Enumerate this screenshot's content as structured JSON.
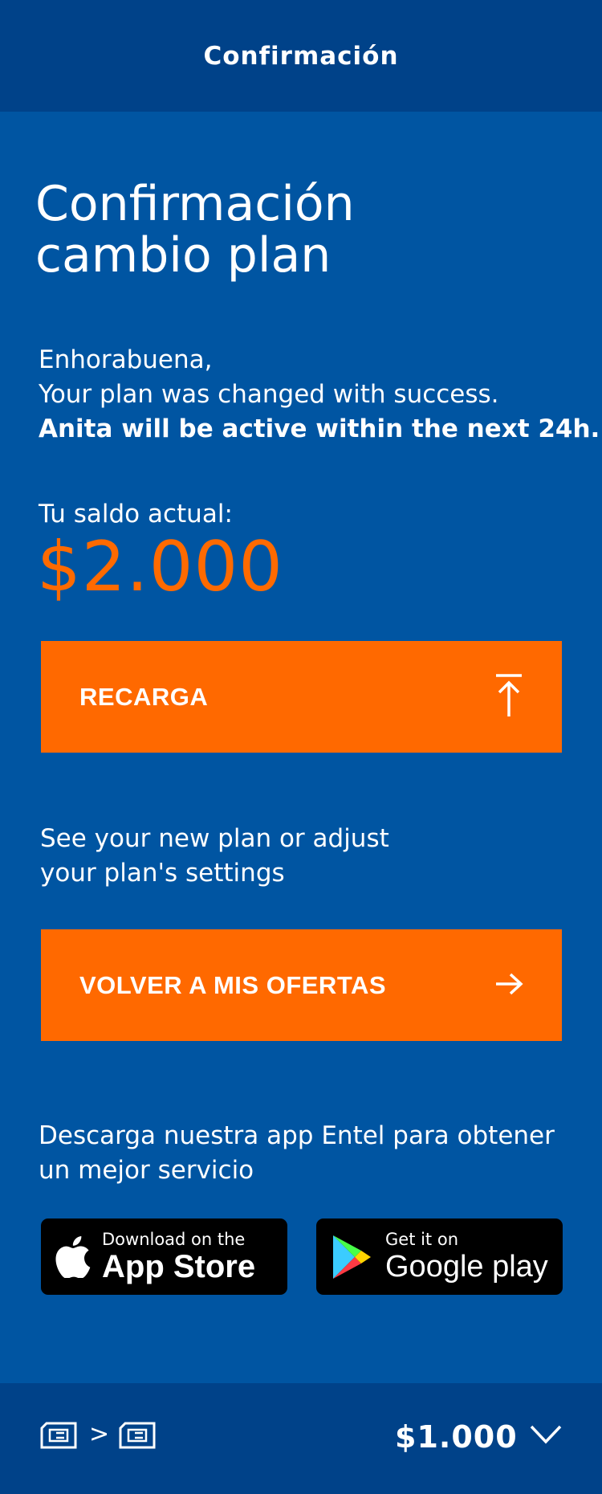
{
  "header": {
    "title": "Confirmación"
  },
  "page_title": {
    "line1": "Confirmación",
    "line2": "cambio plan"
  },
  "message": {
    "greeting": "Enhorabuena,",
    "success": "Your plan was changed with success.",
    "activation": "Anita will be active within the next 24h."
  },
  "balance": {
    "label": "Tu saldo actual:",
    "value": "$2.000"
  },
  "recarga_button": {
    "label": "RECARGA",
    "icon": "upload-arrow-icon"
  },
  "plan_prompt": {
    "line1": "See your new plan or adjust",
    "line2": "your plan's settings"
  },
  "ofertas_button": {
    "label": "VOLVER A MIS OFERTAS",
    "icon": "arrow-right-icon"
  },
  "app_promo": {
    "line1": "Descarga nuestra app Entel para obtener",
    "line2": "un mejor servicio"
  },
  "app_store": {
    "small": "Download on the",
    "big": "App Store"
  },
  "google_play": {
    "small": "Get it on",
    "big": "Google play"
  },
  "bottom_bar": {
    "separator": ">",
    "amount": "$1.000",
    "icons": [
      "sim-card-icon",
      "sim-card-icon",
      "chevron-down-icon"
    ]
  },
  "colors": {
    "background": "#0055a2",
    "header_background": "#004289",
    "accent": "#ff6900",
    "badge_background": "#000000"
  }
}
